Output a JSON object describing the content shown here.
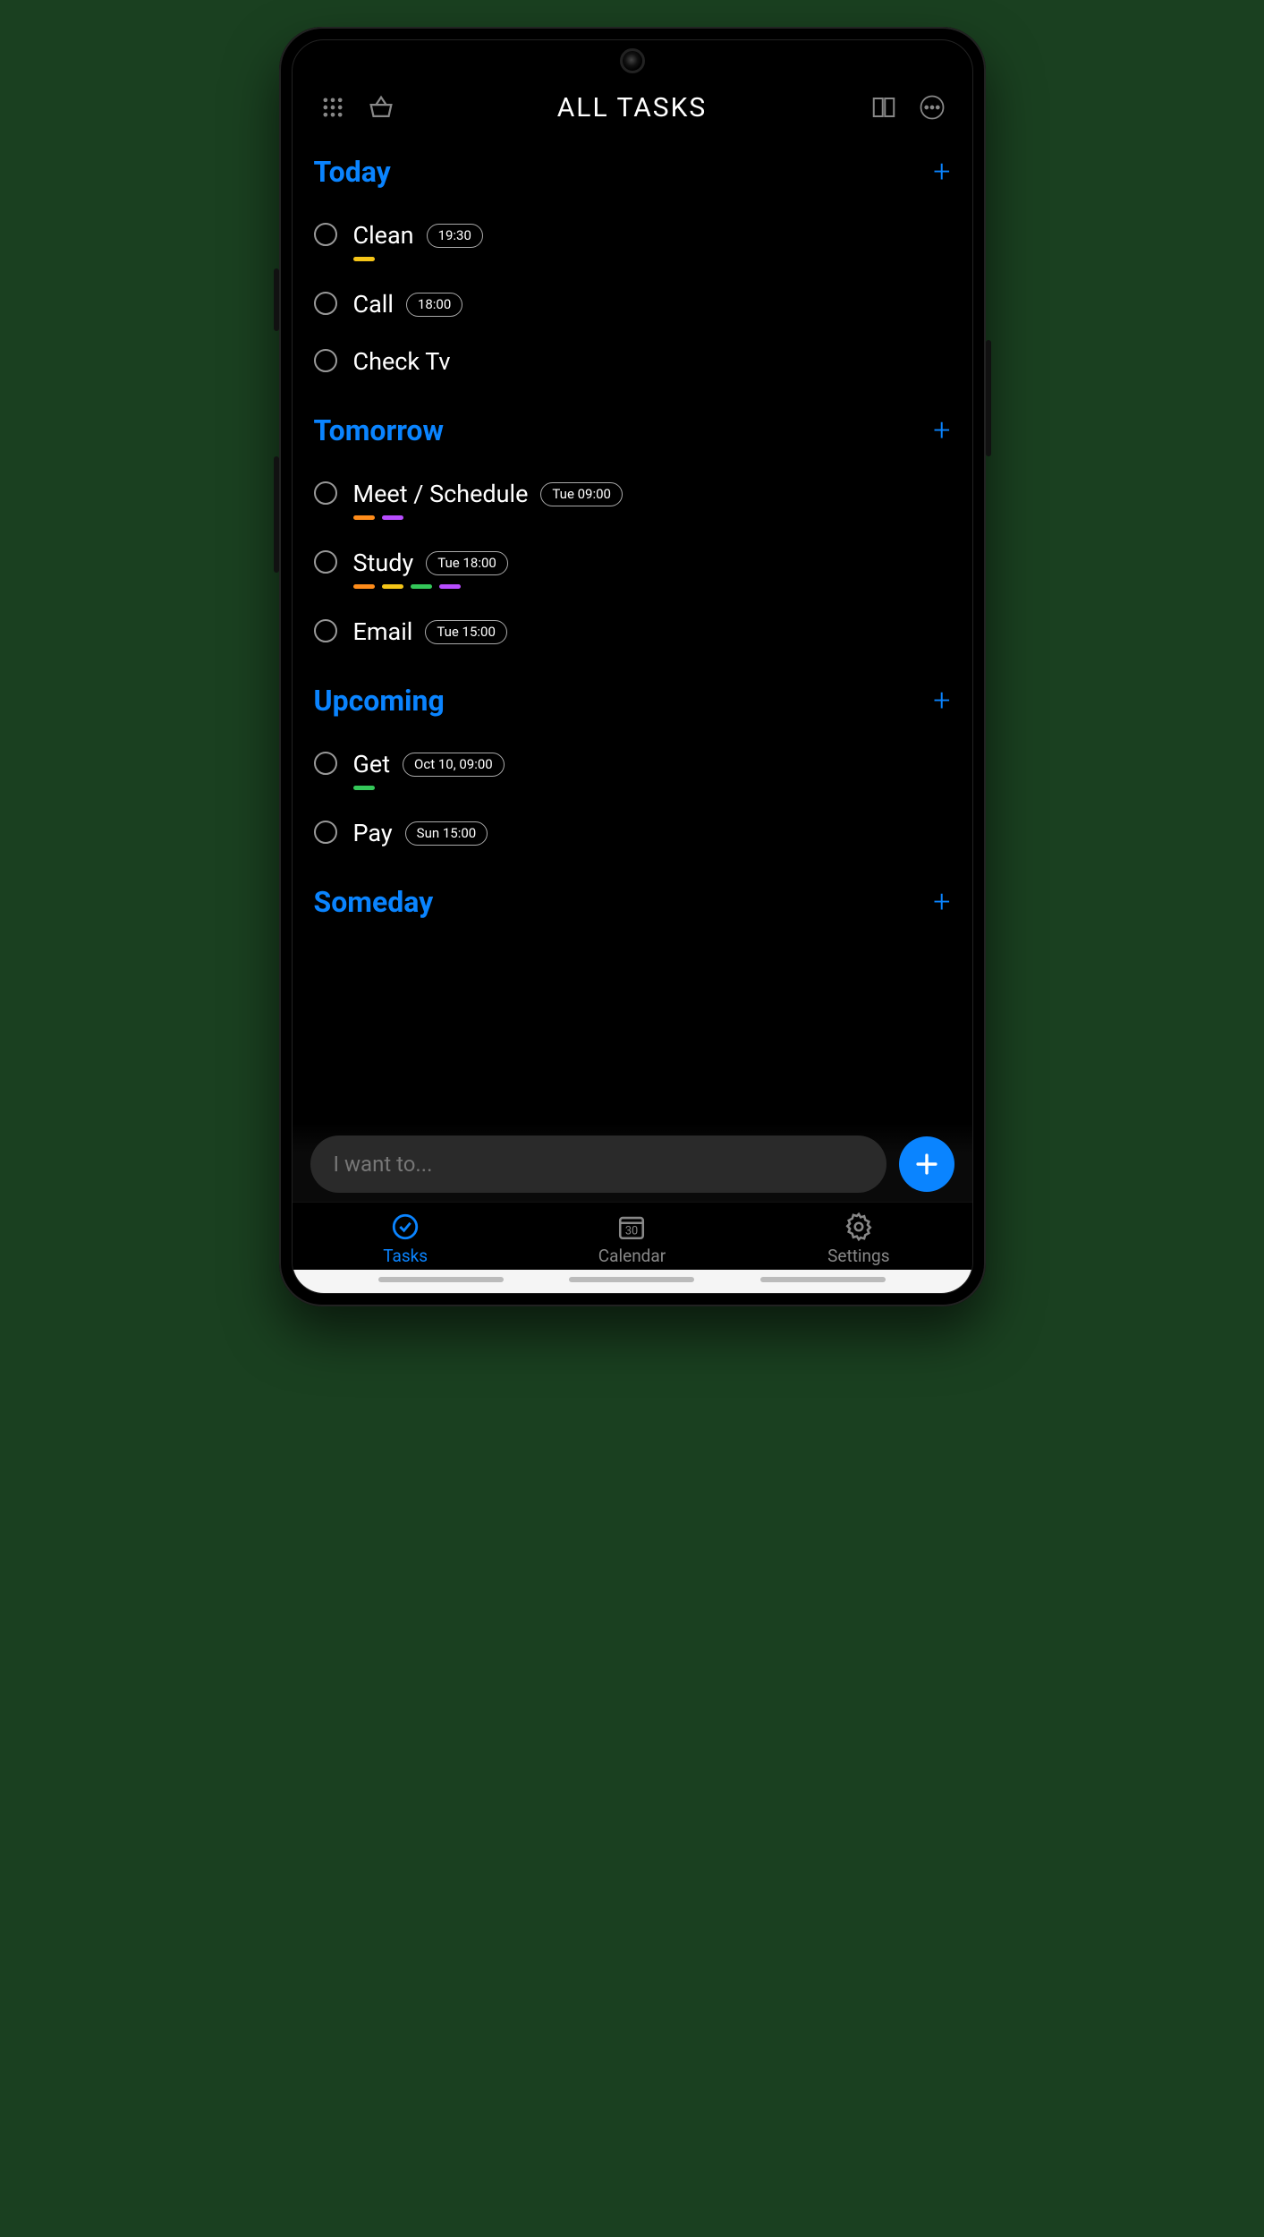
{
  "header": {
    "title": "ALL TASKS"
  },
  "sections": [
    {
      "id": "today",
      "title": "Today",
      "tasks": [
        {
          "label": "Clean",
          "time": "19:30",
          "tags": [
            "#f5c518"
          ]
        },
        {
          "label": "Call",
          "time": "18:00",
          "tags": []
        },
        {
          "label": "Check Tv",
          "time": null,
          "tags": []
        }
      ]
    },
    {
      "id": "tomorrow",
      "title": "Tomorrow",
      "tasks": [
        {
          "label": "Meet / Schedule",
          "time": "Tue 09:00",
          "tags": [
            "#ff8c1a",
            "#b84dff"
          ]
        },
        {
          "label": "Study",
          "time": "Tue 18:00",
          "tags": [
            "#ff8c1a",
            "#f5c518",
            "#34c759",
            "#b84dff"
          ]
        },
        {
          "label": "Email",
          "time": "Tue 15:00",
          "tags": []
        }
      ]
    },
    {
      "id": "upcoming",
      "title": "Upcoming",
      "tasks": [
        {
          "label": "Get",
          "time": "Oct 10, 09:00",
          "tags": [
            "#34c759"
          ]
        },
        {
          "label": "Pay",
          "time": "Sun 15:00",
          "tags": []
        }
      ]
    },
    {
      "id": "someday",
      "title": "Someday",
      "tasks": []
    }
  ],
  "input": {
    "placeholder": "I want to..."
  },
  "nav": {
    "tasks": "Tasks",
    "calendar": "Calendar",
    "calendar_day": "30",
    "settings": "Settings"
  },
  "colors": {
    "accent": "#0a84ff"
  }
}
